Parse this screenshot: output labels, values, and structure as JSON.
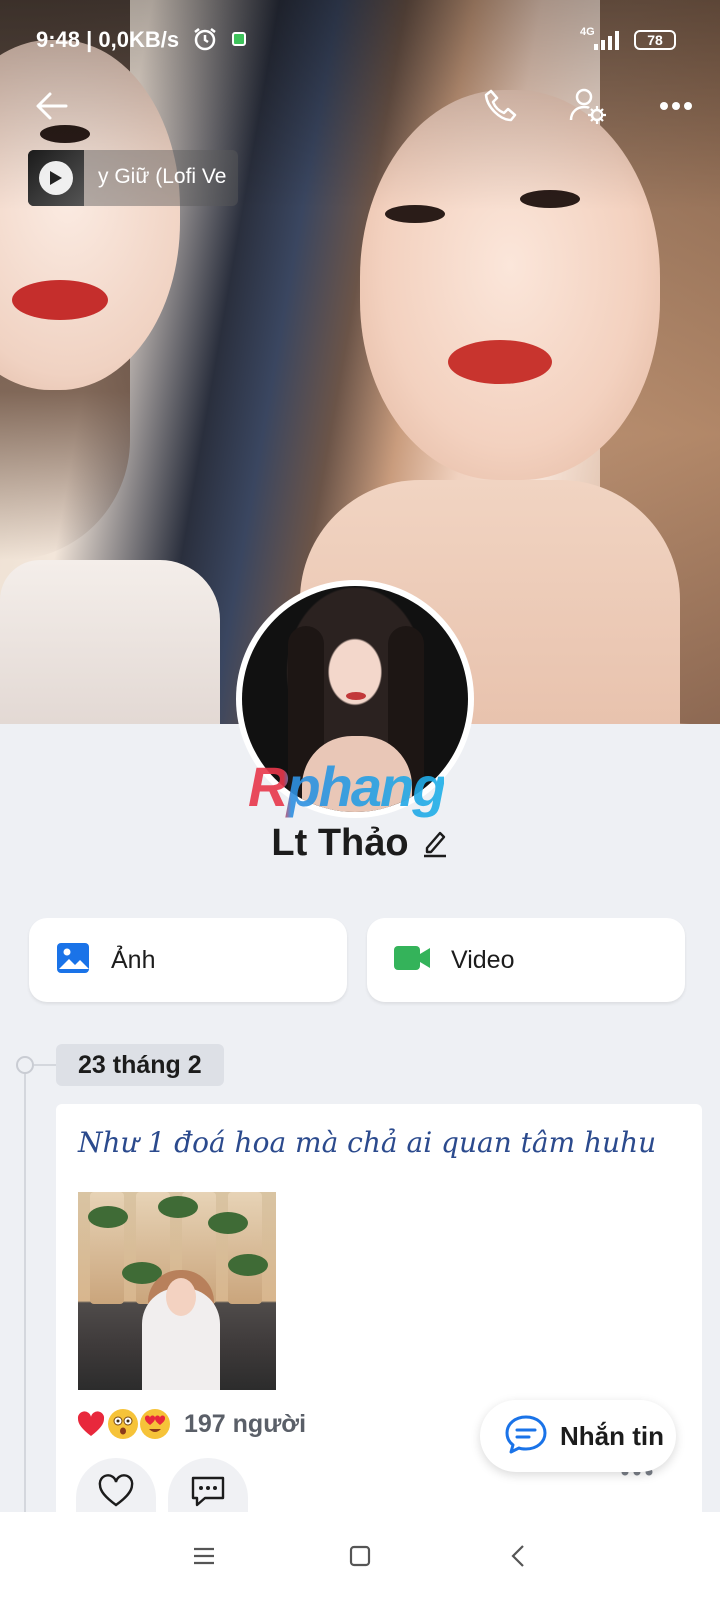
{
  "status_bar": {
    "time_speed": "9:48 | 0,0KB/s",
    "network": "4G",
    "battery": "78"
  },
  "header": {
    "icons": [
      "back-arrow-icon",
      "phone-icon",
      "user-settings-icon",
      "more-dots-icon"
    ]
  },
  "music": {
    "track_title": "y Giữ (Lofi Ve"
  },
  "profile": {
    "name": "Lt Thảo",
    "watermark": "Rphang"
  },
  "media": {
    "photo_label": "Ảnh",
    "video_label": "Video"
  },
  "timeline": {
    "date": "23 tháng 2"
  },
  "post": {
    "text": "Như 1 đoá hoa mà chả ai quan tâm huhu",
    "reaction_count": "197 người",
    "reactions": [
      "heart-emoji",
      "shocked-emoji",
      "heart-eyes-emoji"
    ]
  },
  "message_button": {
    "label": "Nhắn tin"
  },
  "colors": {
    "accent_blue": "#1a73e8",
    "video_green": "#34b35a",
    "post_text": "#2b4a8d"
  }
}
